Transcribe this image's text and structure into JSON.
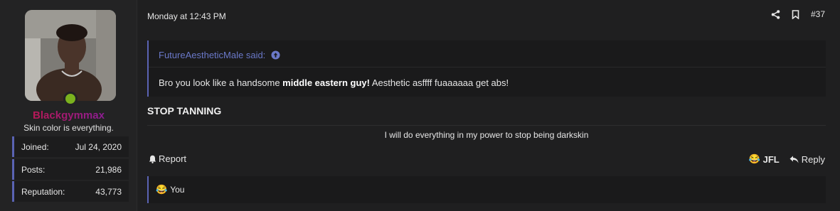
{
  "user": {
    "username": "Blackgymmax",
    "title": "Skin color is everything.",
    "stats": [
      {
        "label": "Joined:",
        "value": "Jul 24, 2020"
      },
      {
        "label": "Posts:",
        "value": "21,986"
      },
      {
        "label": "Reputation:",
        "value": "43,773"
      }
    ]
  },
  "post": {
    "date": "Monday at 12:43 PM",
    "number": "#37",
    "quote": {
      "author": "FutureAestheticMale said:",
      "body_prefix": "Bro you look like a handsome ",
      "body_bold": "middle eastern guy!",
      "body_suffix": " Aesthetic asffff fuaaaaaa get abs!"
    },
    "heading": "STOP TANNING",
    "centered_text": "I will do everything in my power to stop being darkskin",
    "report_label": "Report",
    "jfl_label": "JFL",
    "reply_label": "Reply",
    "reaction_text": "You"
  },
  "icons": {
    "share": "share-icon",
    "bookmark": "bookmark-icon",
    "bell": "bell-icon",
    "reply": "reply-arrow-icon",
    "laugh": "laughing-emoji-icon",
    "arrow_up": "arrow-up-circle-icon"
  },
  "colors": {
    "accent": "#5a63b3",
    "quote_author": "#6a78c8",
    "online": "#7bb21e",
    "username_gradient_start": "#c9163a",
    "username_gradient_end": "#7a1fb0"
  }
}
